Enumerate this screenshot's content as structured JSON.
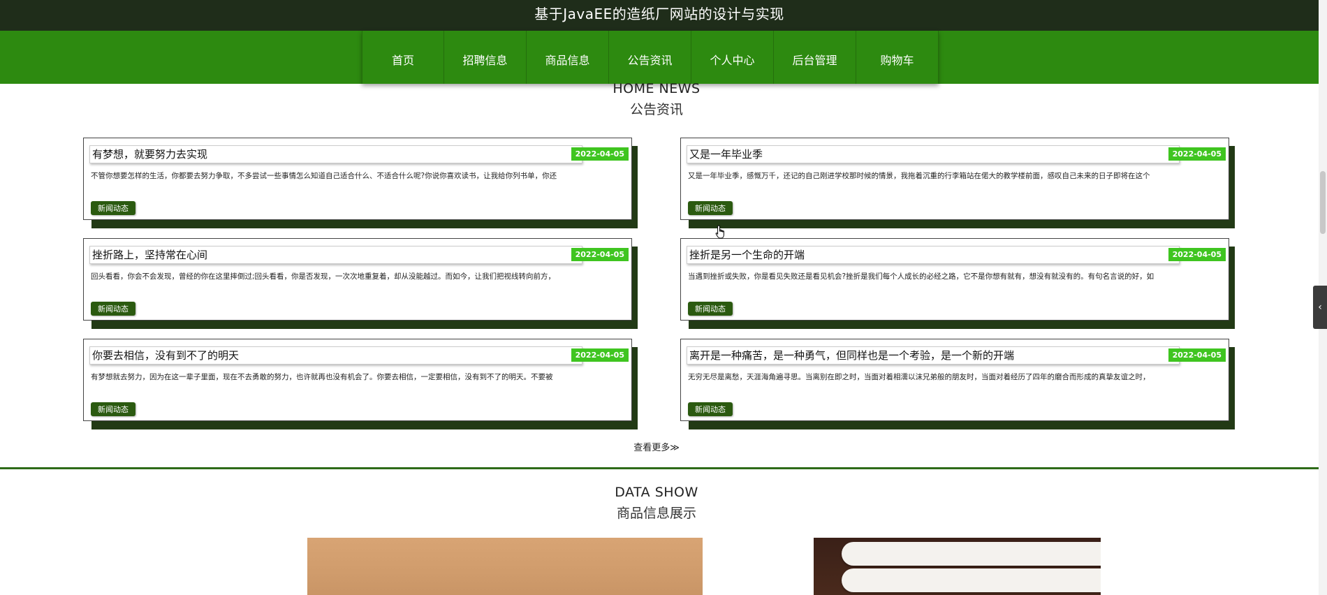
{
  "header": {
    "title": "基于JavaEE的造纸厂网站的设计与实现"
  },
  "nav": {
    "items": [
      "首页",
      "招聘信息",
      "商品信息",
      "公告资讯",
      "个人中心",
      "后台管理",
      "购物车"
    ]
  },
  "news_section": {
    "title_en": "HOME NEWS",
    "title_cn": "公告资讯"
  },
  "news": [
    {
      "title": "有梦想，就要努力去实现",
      "date": "2022-04-05",
      "desc": "不管你想要怎样的生活，你都要去努力争取，不多尝试一些事情怎么知道自己适合什么、不适合什么呢?你说你喜欢读书，让我给你列书单，你还",
      "tag": "新闻动态"
    },
    {
      "title": "又是一年毕业季",
      "date": "2022-04-05",
      "desc": "又是一年毕业季，感慨万千，还记的自己刚进学校那时候的情景，我拖着沉重的行李箱站在偌大的教学楼前面，感叹自己未来的日子即将在这个",
      "tag": "新闻动态"
    },
    {
      "title": "挫折路上，坚持常在心间",
      "date": "2022-04-05",
      "desc": "回头看看，你会不会发现，曾经的你在这里摔倒过;回头看看，你是否发现，一次次地重复着，却从没能越过。而如今，让我们把视线转向前方，",
      "tag": "新闻动态"
    },
    {
      "title": "挫折是另一个生命的开端",
      "date": "2022-04-05",
      "desc": "当遇到挫折或失败，你是看见失败还是看见机会?挫折是我们每个人成长的必经之路，它不是你想有就有，想没有就没有的。有句名言说的好，如",
      "tag": "新闻动态"
    },
    {
      "title": "你要去相信，没有到不了的明天",
      "date": "2022-04-05",
      "desc": "有梦想就去努力，因为在这一辈子里面，现在不去勇敢的努力，也许就再也没有机会了。你要去相信，一定要相信，没有到不了的明天。不要被",
      "tag": "新闻动态"
    },
    {
      "title": "离开是一种痛苦，是一种勇气，但同样也是一个考验，是一个新的开端",
      "date": "2022-04-05",
      "desc": "无穷无尽是离愁，天涯海角遍寻思。当离别在即之时，当面对着相濡以沫兄弟般的朋友时，当面对着经历了四年的磨合而形成的真挚友谊之时，",
      "tag": "新闻动态"
    }
  ],
  "more_link": "查看更多≫",
  "product_section": {
    "title_en": "DATA SHOW",
    "title_cn": "商品信息展示"
  },
  "colors": {
    "nav_green": "#2d8a10",
    "top_dark": "#1f2d1a",
    "date_badge": "#3fc520",
    "tag_green": "#2b5a10"
  }
}
